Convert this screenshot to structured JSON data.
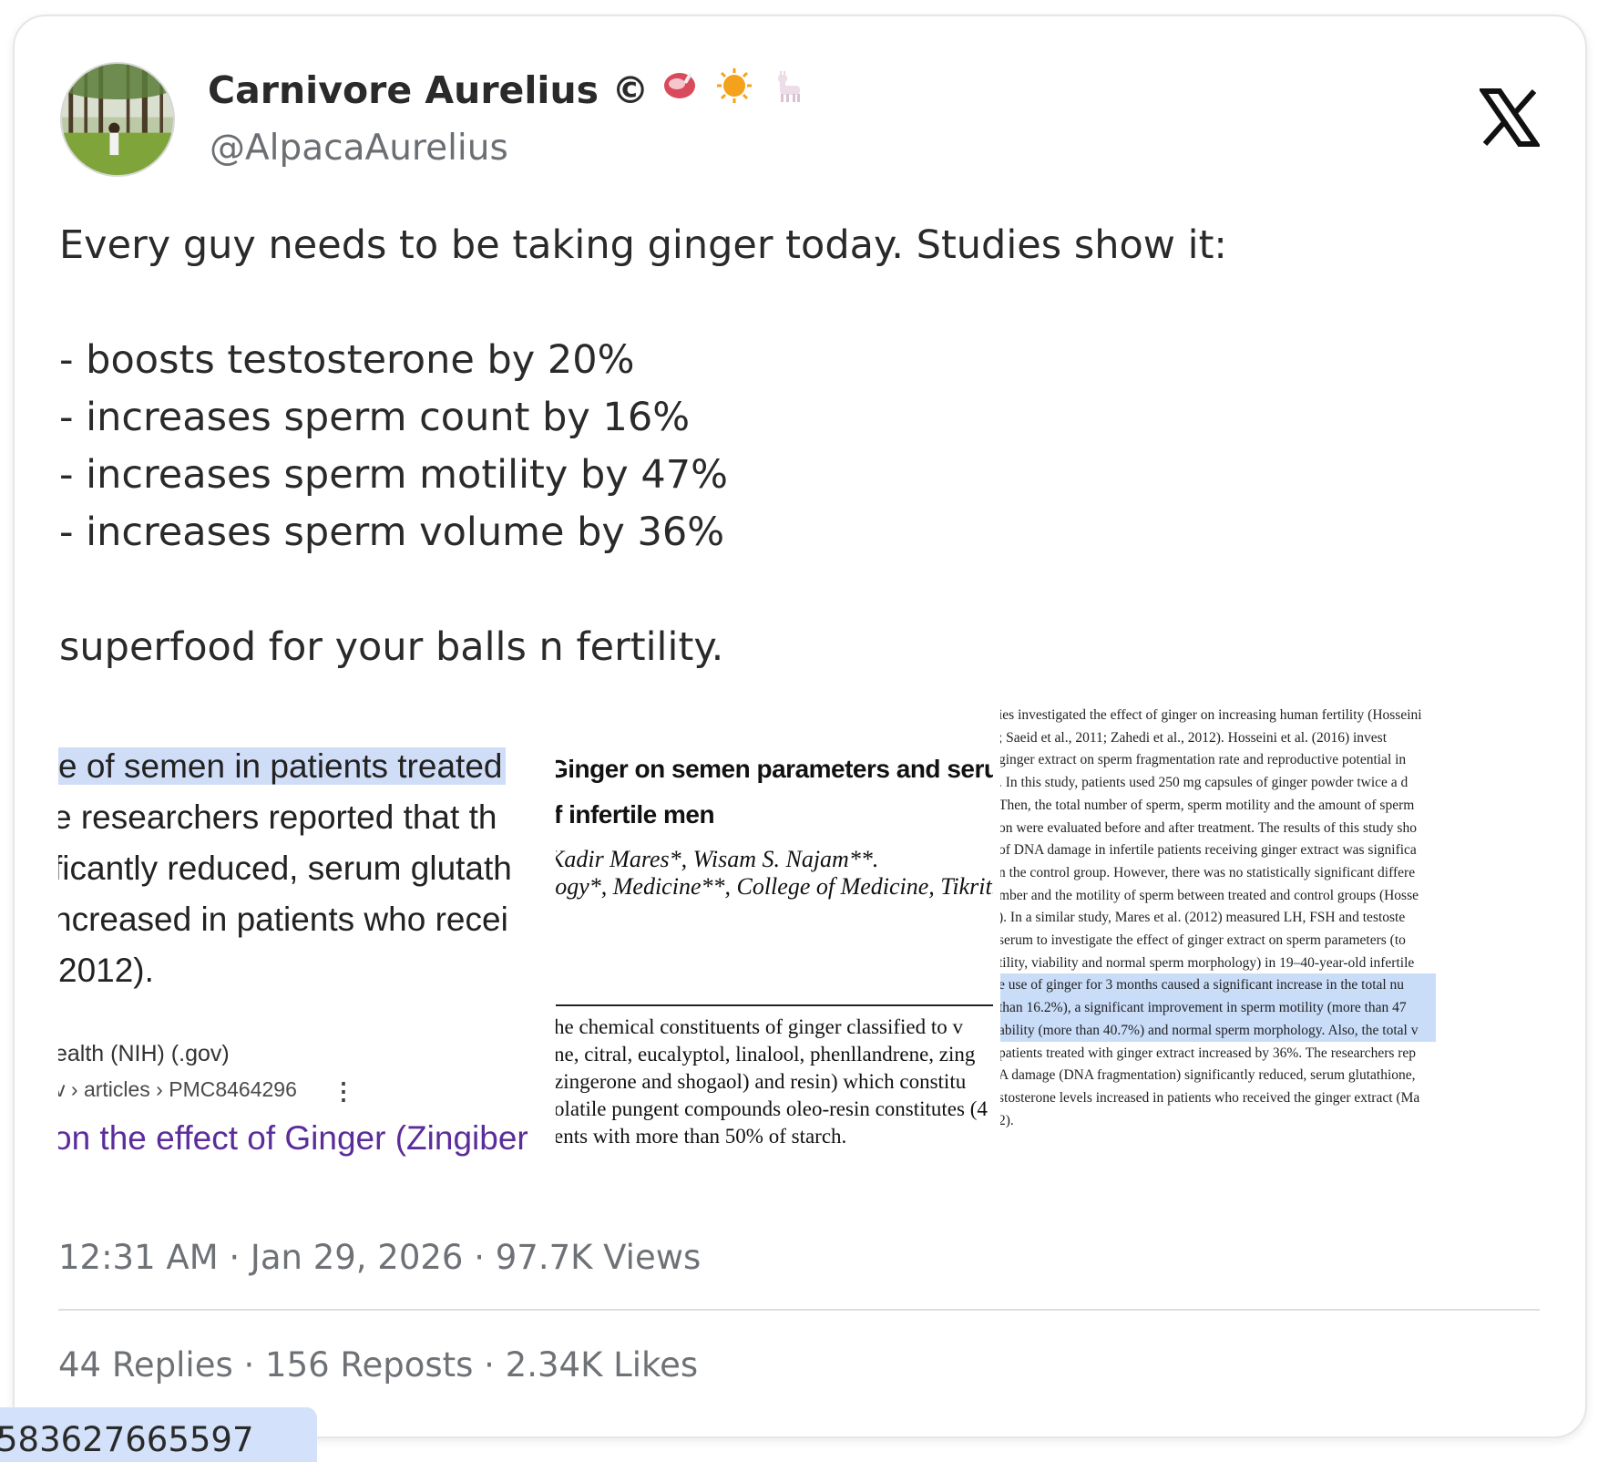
{
  "author": {
    "name": "Carnivore Aurelius ©",
    "handle": "@AlpacaAurelius",
    "badge_icons": [
      "meat-icon",
      "sun-icon",
      "llama-icon"
    ]
  },
  "tweet": {
    "text": "Every guy needs to be taking ginger today. Studies show it:\n\n- boosts testosterone by 20%\n- increases sperm count by 16%\n- increases sperm motility by 47%\n- increases sperm volume by 36%\n\nsuperfood for your balls n fertility."
  },
  "media": {
    "panel1": {
      "lines": [
        "e of semen in patients treated",
        "e researchers reported that th",
        "ficantly reduced, serum glutath",
        "ncreased in patients who recei",
        "2012)."
      ],
      "source": "ealth (NIH) (.gov)",
      "breadcrumb": "v › articles › PMC8464296",
      "link_title": "on the effect of Ginger (Zingiber"
    },
    "panel2": {
      "title_lines": [
        "Ginger on semen parameters and serum FSH",
        "f infertile men"
      ],
      "author_lines": [
        "Kadir Mares*, Wisam S. Najam**.",
        "logy*, Medicine**, College of Medicine, Tikrit."
      ],
      "body_lines": [
        "he chemical constituents of ginger classified to v",
        "ne, citral, eucalyptol, linalool, phenllandrene, zing",
        " zingerone and shogaol) and resin) which constitu",
        "olatile pungent compounds oleo-resin constitutes (4",
        "ents with more than 50% of starch."
      ]
    },
    "panel3": {
      "lines": [
        "ies investigated the effect of ginger on increasing human fertility (Hosseini",
        "; Saeid et al., 2011; Zahedi et al., 2012). Hosseini et al. (2016) invest",
        " ginger extract on sperm fragmentation rate and reproductive potential in",
        ". In this study, patients used 250 mg capsules of ginger powder twice a d",
        "Then, the total number of sperm, sperm motility and the amount of sperm",
        "on were evaluated before and after treatment. The results of this study sho",
        " of DNA damage in infertile patients receiving ginger extract was significa",
        "n the control group. However, there was no statistically significant differe",
        "mber and the motility of sperm between treated and control groups (Hosse",
        "). In a similar study, Mares et al. (2012) measured LH, FSH and testoste",
        " serum to investigate the effect of ginger extract on sperm parameters (to",
        "tility, viability and normal sperm morphology) in 19–40-year-old infertile",
        "e use of ginger for 3 months caused a significant increase in the total nu",
        " than 16.2%), a significant improvement in sperm motility (more than 47",
        "ability (more than 40.7%) and normal sperm morphology. Also, the total v",
        " patients treated with ginger extract increased by 36%. The researchers rep",
        "A damage (DNA fragmentation) significantly reduced, serum glutathione,",
        "stosterone levels increased in patients who received the ginger extract (Ma",
        "2)."
      ],
      "highlighted_rows": [
        12,
        13,
        14
      ]
    }
  },
  "meta": {
    "timestamp": "12:31 AM · Jan 29, 2026 · 97.7K Views"
  },
  "stats": {
    "text": "44 Replies · 156 Reposts · 2.34K Likes"
  },
  "url_fragment": "583627665597"
}
